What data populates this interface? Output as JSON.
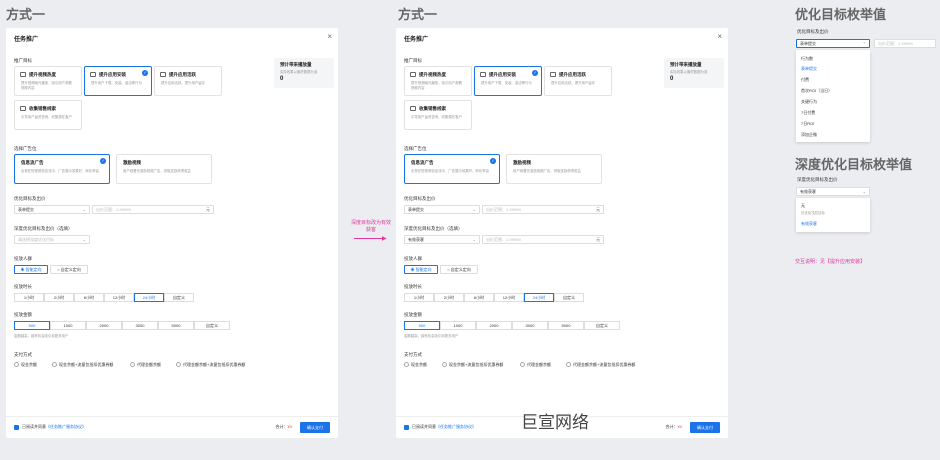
{
  "headers": {
    "left": "方式一",
    "middle": "方式一",
    "right_top": "优化目标枚举值",
    "right_bottom": "深度优化目标枚举值"
  },
  "panel": {
    "title": "任务推广",
    "close": "×",
    "goal_label": "推广目标",
    "goals": [
      {
        "title": "提升视频热度",
        "desc": "提升视频曝光播放，吸引用户观看视频内容"
      },
      {
        "title": "提升应用安装",
        "desc": "提升用户下载、安装、激活等行为"
      },
      {
        "title": "提升应用活跃",
        "desc": "提升应用活跃、提升用户留存"
      },
      {
        "title": "收集销售线索",
        "desc": "引导用户留资咨询、收集潜在客户"
      }
    ],
    "stat": {
      "title": "预计带来播放量",
      "sub": "实际效果以最终数据为准",
      "value": "0"
    },
    "slot_label": "选择广告位",
    "slots": [
      {
        "title": "信息流广告",
        "desc": "出现在短视频信息流中，广告展示效果好，转化率高"
      },
      {
        "title": "激励视频",
        "desc": "用户观看完激励视频广告，领取奖励获得收益"
      }
    ],
    "opt_label": "优化目标及出价",
    "opt_value_left": "表单提交",
    "opt_value_right": "有效获客",
    "bid_placeholder": "出价范围：1-99999",
    "bid_unit": "元",
    "deep_label": "深度优化目标及出价（选填）",
    "deep_placeholder": "请选择深度优化目标",
    "audience_label": "投放人群",
    "audience_opts": [
      "智能定向",
      "自定义定向"
    ],
    "duration_label": "投放时长",
    "durations": [
      "1小时",
      "2小时",
      "6小时",
      "12小时",
      "24小时",
      "自定义"
    ],
    "amount_label": "投放金额",
    "amounts": [
      "500",
      "1000",
      "2000",
      "3000",
      "5000",
      "自定义"
    ],
    "amount_hint": "金额越高，越有机会吸引到更多用户",
    "pay_label": "支付方式",
    "pays": [
      "现金余额",
      "现金余额+流量包抵扣优惠券额",
      "代理金额余额",
      "代理金额余额+流量包抵扣优惠券额"
    ],
    "agree_pre": "已阅读并同意",
    "agree_link": "《任务推广服务协议》",
    "total_label": "合计：",
    "total_value": "¥0",
    "confirm": "确认支付"
  },
  "arrow_note": "深度目标改为有效获客",
  "watermark": "巨宣网络",
  "right": {
    "label1": "优化目标及出价",
    "sel1": "表单提交",
    "ph1": "出价范围：1-99999",
    "list1": [
      "行为数",
      "表单提交",
      "付费",
      "首次ROI（当日）",
      "关键行为",
      "7日付费",
      "7日ROI",
      "添加企微"
    ],
    "label2": "深度优化目标及出价",
    "sel2": "有效获客",
    "list2_items": [
      {
        "t": "无",
        "sub": "仅优化浅层目标"
      },
      {
        "t": "有效获客",
        "sub": ""
      }
    ],
    "note": "交互说明：见【提升应用安装】"
  },
  "colors": {
    "accent": "#1a73e8",
    "pink": "#e0389f"
  }
}
